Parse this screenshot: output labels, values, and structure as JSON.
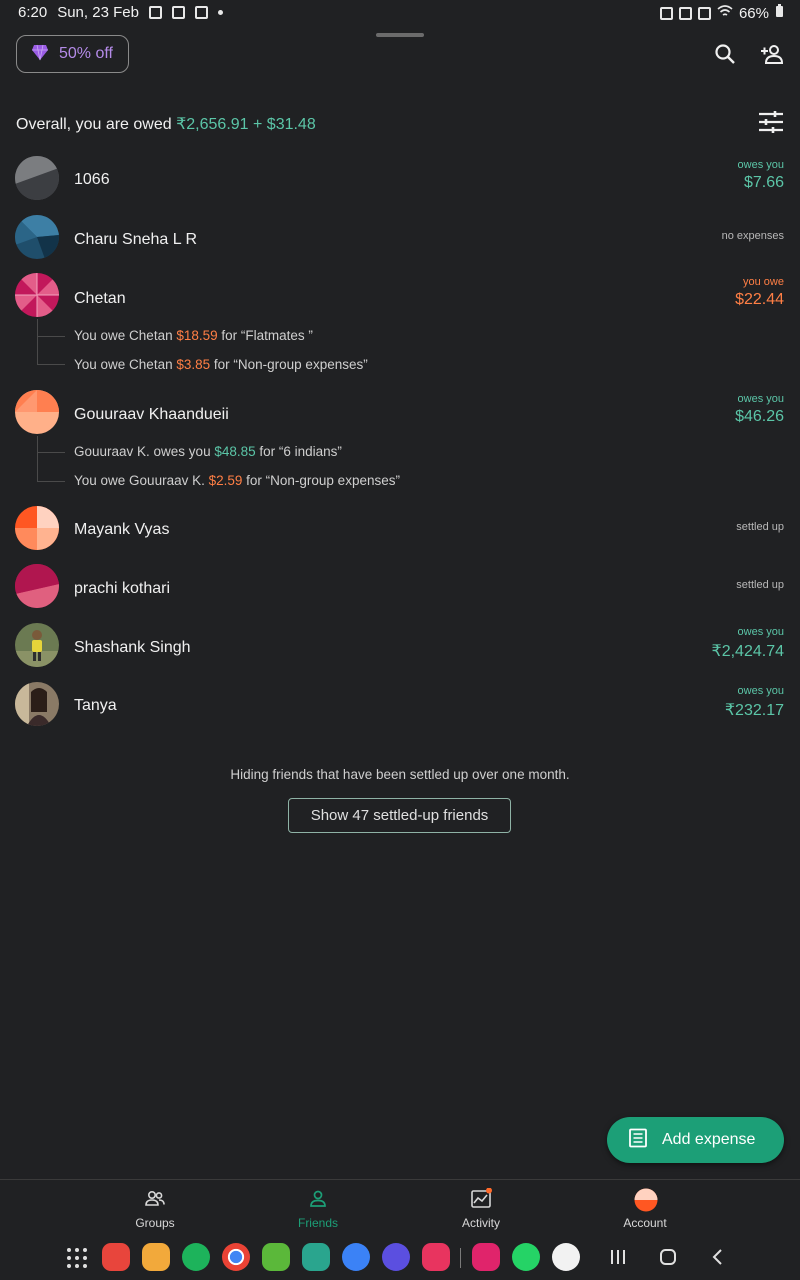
{
  "status_bar": {
    "time": "6:20",
    "date": "Sun, 23 Feb",
    "battery": "66%"
  },
  "header": {
    "promo_label": "50% off",
    "overall_prefix": "Overall, you are owed",
    "overall_amount": "₹2,656.91 + $31.48"
  },
  "friends": [
    {
      "name": "1066",
      "status_kind": "owes you",
      "status_value": "$7.66"
    },
    {
      "name": "Charu Sneha L R",
      "status_kind": "no expenses",
      "status_value": ""
    },
    {
      "name": "Chetan",
      "status_kind": "you owe",
      "status_value": "$22.44",
      "details": [
        {
          "pre": "You owe Chetan ",
          "amount": "$18.59",
          "post": " for “Flatmates ”"
        },
        {
          "pre": "You owe Chetan ",
          "amount": "$3.85",
          "post": " for “Non-group expenses”"
        }
      ]
    },
    {
      "name": "Gouuraav Khaandueii",
      "status_kind": "owes you",
      "status_value": "$46.26",
      "details": [
        {
          "pre": "Gouuraav K. owes you ",
          "amount": "$48.85",
          "post": " for “6 indians”"
        },
        {
          "pre": "You owe Gouuraav K. ",
          "amount": "$2.59",
          "post": " for “Non-group expenses”"
        }
      ]
    },
    {
      "name": "Mayank Vyas",
      "status_kind": "settled up",
      "status_value": ""
    },
    {
      "name": "prachi kothari",
      "status_kind": "settled up",
      "status_value": ""
    },
    {
      "name": "Shashank Singh",
      "status_kind": "owes you",
      "status_value": "₹2,424.74"
    },
    {
      "name": "Tanya",
      "status_kind": "owes you",
      "status_value": "₹232.17"
    }
  ],
  "footer_note": "Hiding friends that have been settled up over one month.",
  "show_settled_button": "Show 47 settled-up friends",
  "fab_label": "Add expense",
  "nav": [
    {
      "label": "Groups"
    },
    {
      "label": "Friends"
    },
    {
      "label": "Activity"
    },
    {
      "label": "Account"
    }
  ],
  "colors": {
    "accent": "#1c9f77",
    "owed": "#5bc5a7",
    "owe": "#ff7f45",
    "background": "#202123"
  }
}
